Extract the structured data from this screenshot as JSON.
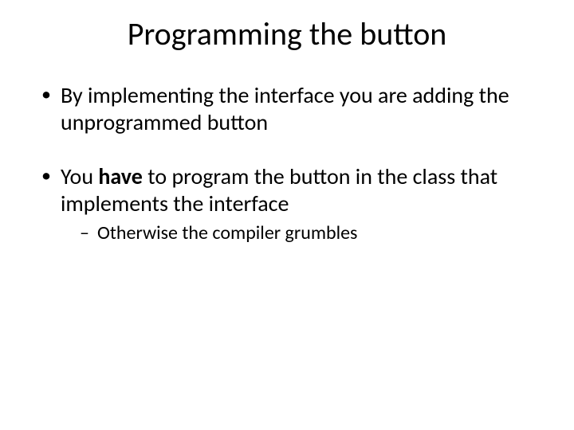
{
  "title": "Programming the button",
  "bullets": [
    {
      "text_before": "By implementing the interface you are adding the unprogrammed button",
      "bold": "",
      "text_after": "",
      "sub": []
    },
    {
      "text_before": "You ",
      "bold": "have",
      "text_after": " to program the button in the class that implements the interface",
      "sub": [
        {
          "text": "Otherwise the compiler grumbles"
        }
      ]
    }
  ]
}
